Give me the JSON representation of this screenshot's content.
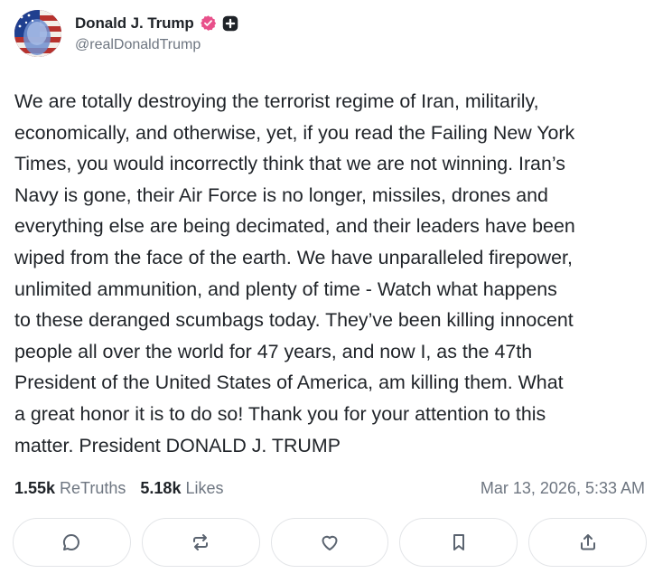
{
  "author": {
    "display_name": "Donald J. Trump",
    "handle": "@realDonaldTrump",
    "avatar_icon": "avatar-portrait-flag",
    "verified_icon": "verified-badge-icon",
    "verified_color": "#e8508a",
    "plus_icon": "plus-badge-icon"
  },
  "post": {
    "text": "We are totally destroying the terrorist regime of Iran, militarily,\neconomically, and otherwise, yet, if you read the Failing New York\nTimes, you would incorrectly think that we are not winning. Iran’s\nNavy is gone, their Air Force is no longer, missiles, drones and\neverything else are being decimated, and their leaders have been\nwiped from the face of the earth. We have unparalleled firepower,\nunlimited ammunition, and plenty of time - Watch what happens\nto these deranged scumbags today. They’ve been killing innocent\npeople all over the world for 47 years, and now I, as the 47th\nPresident of the United States of America, am killing them. What\na great honor it is to do so! Thank you for your attention to this\nmatter. President DONALD J. TRUMP"
  },
  "stats": {
    "retruths_count": "1.55k",
    "retruths_label": "ReTruths",
    "likes_count": "5.18k",
    "likes_label": "Likes",
    "timestamp": "Mar 13, 2026, 5:33 AM"
  },
  "actions": [
    {
      "name": "reply",
      "icon": "comment-bubble-icon"
    },
    {
      "name": "retruth",
      "icon": "repost-arrows-icon"
    },
    {
      "name": "like",
      "icon": "heart-icon"
    },
    {
      "name": "bookmark",
      "icon": "bookmark-icon"
    },
    {
      "name": "share",
      "icon": "share-upload-icon"
    }
  ],
  "colors": {
    "text": "#1f2328",
    "muted": "#6e7681",
    "border": "#e3e5e8",
    "icon": "#5b6470"
  }
}
